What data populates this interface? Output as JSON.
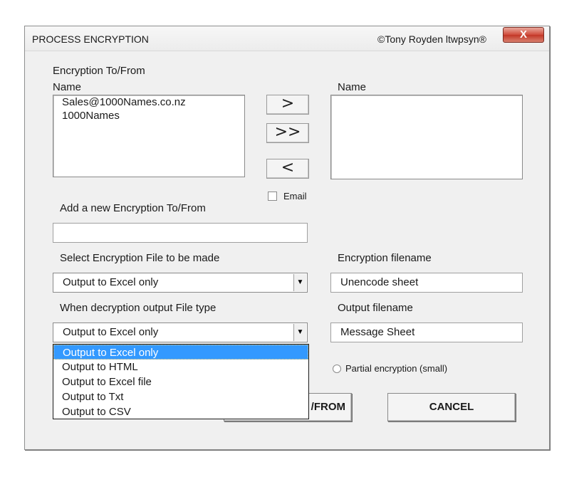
{
  "window": {
    "title": "PROCESS ENCRYPTION",
    "copyright": "©Tony Royden ltwpsyn®",
    "close_label": "X"
  },
  "left_list": {
    "heading": "Encryption To/From",
    "column_label": "Name",
    "items": [
      "Sales@1000Names.co.nz",
      "1000Names"
    ]
  },
  "right_list": {
    "column_label": "Name",
    "items": []
  },
  "buttons": {
    "add_one": ">",
    "add_all": ">>",
    "remove_one": "<",
    "process_label_visible": "/FROM",
    "cancel": "CANCEL"
  },
  "email_checkbox": {
    "label": "Email",
    "checked": false
  },
  "new_entry": {
    "label": "Add a new Encryption To/From",
    "value": ""
  },
  "encryption_file": {
    "label": "Select Encryption File to be made",
    "selected": "Output to Excel only"
  },
  "encryption_filename": {
    "label": "Encryption filename",
    "value": "Unencode sheet"
  },
  "decryption_type": {
    "label": "When decryption output File type",
    "selected": "Output to Excel only",
    "options": [
      "Output to Excel only",
      "Output to HTML",
      "Output to Excel file",
      "Output to Txt",
      "Output to CSV"
    ]
  },
  "output_filename": {
    "label": "Output filename",
    "value": "Message Sheet"
  },
  "partial_radio": {
    "label": "Partial encryption (small)",
    "selected": false
  }
}
